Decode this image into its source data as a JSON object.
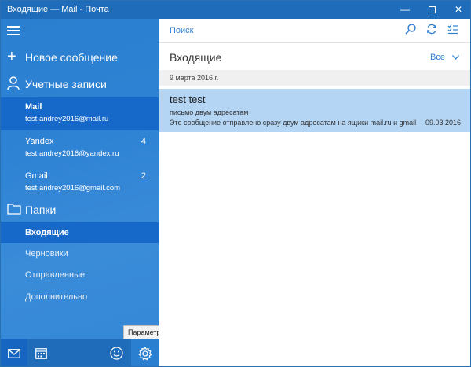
{
  "window": {
    "title": "Входящие — Mail - Почта",
    "min_glyph": "—",
    "close_glyph": "✕"
  },
  "sidebar": {
    "new_message": "Новое сообщение",
    "accounts_label": "Учетные записи",
    "accounts": [
      {
        "name": "Mail",
        "email": "test.andrey2016@mail.ru",
        "count": ""
      },
      {
        "name": "Yandex",
        "email": "test.andrey2016@yandex.ru",
        "count": "4"
      },
      {
        "name": "Gmail",
        "email": "test.andrey2016@gmail.com",
        "count": "2"
      }
    ],
    "folders_label": "Папки",
    "folders": [
      {
        "label": "Входящие"
      },
      {
        "label": "Черновики"
      },
      {
        "label": "Отправленные"
      },
      {
        "label": "Дополнительно"
      }
    ]
  },
  "bottombar": {
    "tooltip": "Параметры"
  },
  "main": {
    "search": "Поиск",
    "folder_title": "Входящие",
    "filter": "Все",
    "date_group": "9 марта 2016 г.",
    "message": {
      "from": "test test",
      "subject": "письмо двум адресатам",
      "preview": "Это сообщение отправлено сразу двум адресатам на ящики mail.ru и gmail.com",
      "date": "09.03.2016"
    }
  },
  "colors": {
    "titlebar": "#1f6dba",
    "sidebar": "#2f83d4",
    "selected": "#1769c9",
    "accent": "#2f7fd2",
    "message_selected": "#b5d5f4",
    "arrow": "#e0242a"
  },
  "icons": [
    "hamburger-icon",
    "plus-icon",
    "person-icon",
    "folder-icon",
    "mail-icon",
    "calendar-icon",
    "smiley-icon",
    "gear-icon",
    "search-icon",
    "sync-icon",
    "select-icon",
    "chevron-down-icon"
  ]
}
